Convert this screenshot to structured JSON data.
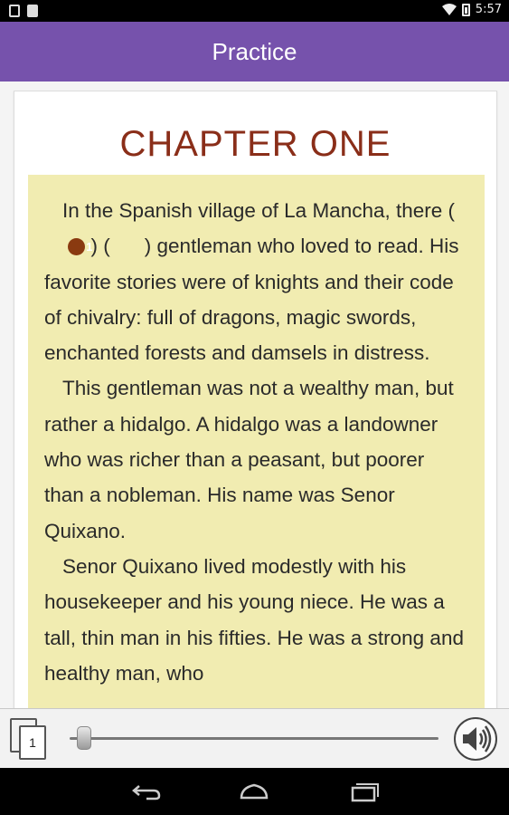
{
  "status_bar": {
    "time": "5:57",
    "left_icons": [
      "sim-icon",
      "storage-icon"
    ],
    "right_icons": [
      "wifi-icon",
      "battery-icon"
    ]
  },
  "app_bar": {
    "title": "Practice"
  },
  "chapter": {
    "title": "CHAPTER ONE",
    "paragraphs": [
      {
        "before_blank": "In the Spanish village of La Mancha, there (",
        "blank_number": "1",
        "after_blank": ") (",
        "after_second_blank": ") gentleman who loved to read. His favorite stories were of knights and their code of chivalry: full of dragons, magic swords, enchanted forests and damsels in distress."
      },
      {
        "text": "This gentleman was not a wealthy man, but rather a hidalgo. A hidalgo was a landowner who was richer than a peasant, but poorer than a nobleman. His name was Senor Quixano."
      },
      {
        "text": "Senor Quixano lived modestly with his housekeeper and his young niece. He was a tall, thin man in his fifties. He was a strong and healthy man, who"
      }
    ]
  },
  "bottom_bar": {
    "page_number": "1",
    "slider_position": 0.02,
    "speaker_icon": "speaker-icon"
  },
  "nav_bar": {
    "buttons": [
      "back-icon",
      "home-icon",
      "recents-icon"
    ]
  },
  "colors": {
    "app_bar": "#7652ac",
    "chapter_title": "#8a2e19",
    "reading_bg": "#f1ecb1",
    "badge": "#8a3a10"
  }
}
